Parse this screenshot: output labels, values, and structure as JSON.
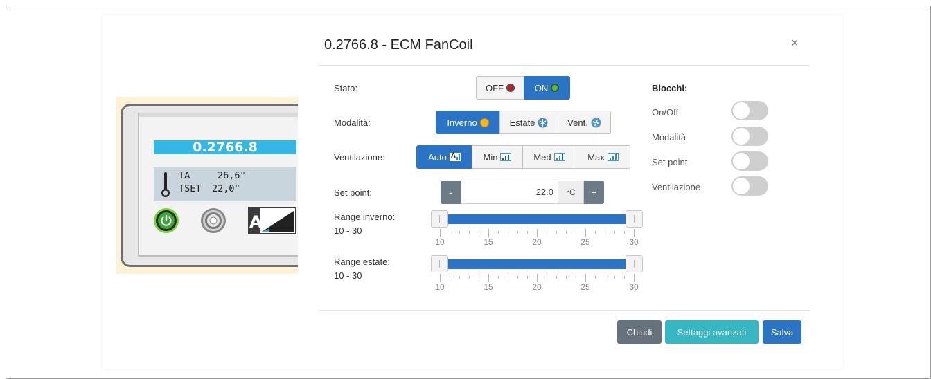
{
  "modal": {
    "title": "0.2766.8 - ECM FanCoil",
    "close_glyph": "×"
  },
  "device": {
    "id": "0.2766.8",
    "ta_label": "TA",
    "ta_value": "26,6°",
    "tset_label": "TSET",
    "tset_value": "22,0°",
    "auto_letter": "A"
  },
  "stato": {
    "label": "Stato:",
    "options": [
      {
        "label": "OFF",
        "icon": "red-dot-icon",
        "active": false
      },
      {
        "label": "ON",
        "icon": "green-dot-icon",
        "active": true
      }
    ]
  },
  "modalita": {
    "label": "Modalità:",
    "options": [
      {
        "label": "Inverno",
        "icon": "sun-icon",
        "active": true
      },
      {
        "label": "Estate",
        "icon": "snowflake-icon",
        "active": false
      },
      {
        "label": "Vent.",
        "icon": "fan-icon",
        "active": false
      }
    ]
  },
  "ventilazione": {
    "label": "Ventilazione:",
    "options": [
      {
        "label": "Auto",
        "icon": "auto-bars-icon",
        "active": true
      },
      {
        "label": "Min",
        "icon": "bars-min-icon",
        "active": false
      },
      {
        "label": "Med",
        "icon": "bars-med-icon",
        "active": false
      },
      {
        "label": "Max",
        "icon": "bars-max-icon",
        "active": false
      }
    ]
  },
  "set_point": {
    "label": "Set point:",
    "minus": "-",
    "value": "22.0",
    "unit": "°C",
    "plus": "+"
  },
  "range_inverno": {
    "label": "Range inverno:",
    "value": "10 - 30",
    "min": 10,
    "max": 30,
    "ticks": [
      "10",
      "15",
      "20",
      "25",
      "30"
    ]
  },
  "range_estate": {
    "label": "Range estate:",
    "value": "10 - 30",
    "min": 10,
    "max": 30,
    "ticks": [
      "10",
      "15",
      "20",
      "25",
      "30"
    ]
  },
  "blocchi": {
    "title": "Blocchi:",
    "items": [
      {
        "label": "On/Off",
        "on": false
      },
      {
        "label": "Modalità",
        "on": false
      },
      {
        "label": "Set point",
        "on": false
      },
      {
        "label": "Ventilazione",
        "on": false
      }
    ]
  },
  "footer": {
    "close_label": "Chiudi",
    "advanced_label": "Settaggi avanzati",
    "save_label": "Salva"
  },
  "colors": {
    "primary": "#2a73c5",
    "info": "#35b7c4",
    "secondary": "#66737e",
    "device_id_bg": "#33b8e6"
  }
}
